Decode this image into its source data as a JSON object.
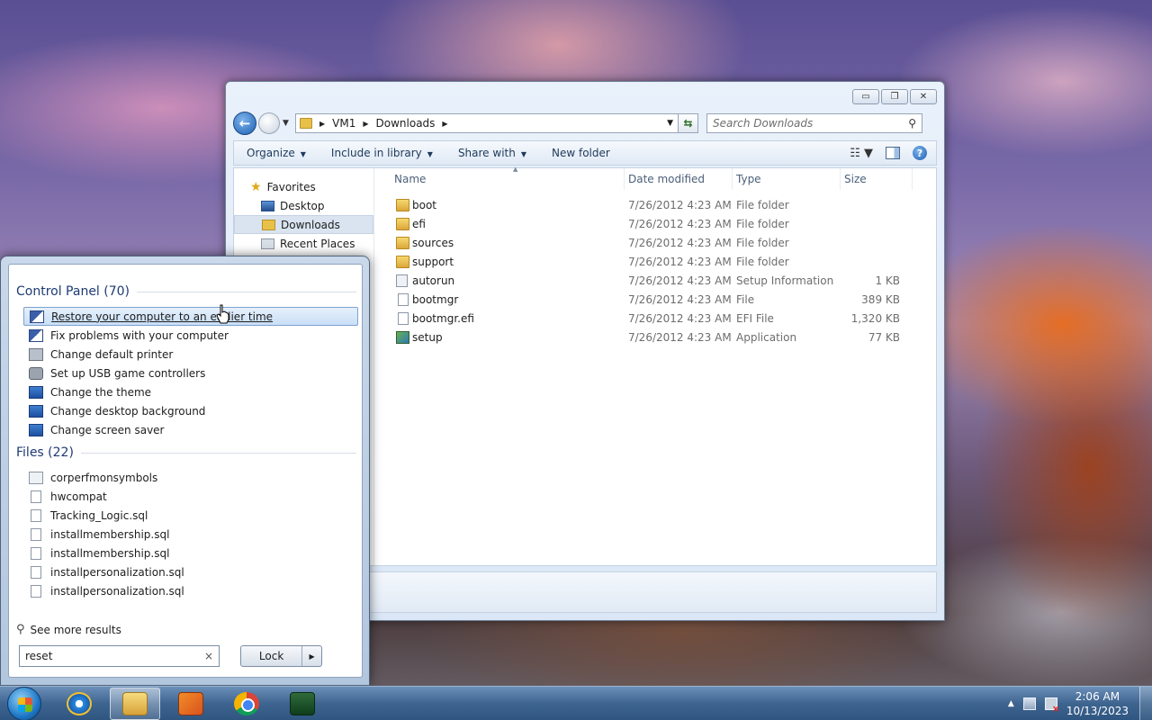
{
  "explorer": {
    "window_controls": {
      "minimize": "▭",
      "maximize": "❐",
      "close": "✕"
    },
    "address": {
      "crumbs": [
        "VM1",
        "Downloads"
      ]
    },
    "search": {
      "placeholder": "Search Downloads"
    },
    "toolbar": {
      "organize": "Organize",
      "include_in_library": "Include in library",
      "share_with": "Share with",
      "new_folder": "New folder"
    },
    "nav_pane": {
      "favorites": "Favorites",
      "items": [
        "Desktop",
        "Downloads",
        "Recent Places"
      ],
      "selected": "Downloads"
    },
    "columns": {
      "name": "Name",
      "date_modified": "Date modified",
      "type": "Type",
      "size": "Size"
    },
    "files": [
      {
        "name": "boot",
        "date": "7/26/2012 4:23 AM",
        "type": "File folder",
        "size": "",
        "icon": "folder-icon"
      },
      {
        "name": "efi",
        "date": "7/26/2012 4:23 AM",
        "type": "File folder",
        "size": "",
        "icon": "folder-icon"
      },
      {
        "name": "sources",
        "date": "7/26/2012 4:23 AM",
        "type": "File folder",
        "size": "",
        "icon": "folder-icon"
      },
      {
        "name": "support",
        "date": "7/26/2012 4:23 AM",
        "type": "File folder",
        "size": "",
        "icon": "folder-icon"
      },
      {
        "name": "autorun",
        "date": "7/26/2012 4:23 AM",
        "type": "Setup Information",
        "size": "1 KB",
        "icon": "settings-file-icon"
      },
      {
        "name": "bootmgr",
        "date": "7/26/2012 4:23 AM",
        "type": "File",
        "size": "389 KB",
        "icon": "file-icon"
      },
      {
        "name": "bootmgr.efi",
        "date": "7/26/2012 4:23 AM",
        "type": "EFI File",
        "size": "1,320 KB",
        "icon": "file-icon"
      },
      {
        "name": "setup",
        "date": "7/26/2012 4:23 AM",
        "type": "Application",
        "size": "77 KB",
        "icon": "application-icon"
      }
    ]
  },
  "start_menu": {
    "control_panel": {
      "heading": "Control Panel (70)",
      "items": [
        {
          "label": "Restore your computer to an earlier time",
          "icon": "action-center-flag-icon",
          "highlighted": true
        },
        {
          "label": "Fix problems with your computer",
          "icon": "action-center-flag-icon",
          "highlighted": false
        },
        {
          "label": "Change default printer",
          "icon": "printer-icon",
          "highlighted": false
        },
        {
          "label": "Set up USB game controllers",
          "icon": "game-controller-icon",
          "highlighted": false
        },
        {
          "label": "Change the theme",
          "icon": "personalization-icon",
          "highlighted": false
        },
        {
          "label": "Change desktop background",
          "icon": "personalization-icon",
          "highlighted": false
        },
        {
          "label": "Change screen saver",
          "icon": "personalization-icon",
          "highlighted": false
        }
      ]
    },
    "files": {
      "heading": "Files (22)",
      "items": [
        {
          "label": "corperfmonsymbols",
          "icon": "settings-file-icon"
        },
        {
          "label": "hwcompat",
          "icon": "text-file-icon"
        },
        {
          "label": "Tracking_Logic.sql",
          "icon": "file-icon"
        },
        {
          "label": "installmembership.sql",
          "icon": "file-icon"
        },
        {
          "label": "installmembership.sql",
          "icon": "file-icon"
        },
        {
          "label": "installpersonalization.sql",
          "icon": "file-icon"
        },
        {
          "label": "installpersonalization.sql",
          "icon": "file-icon"
        }
      ]
    },
    "see_more": "See more results",
    "search": {
      "value": "reset",
      "clear": "×"
    },
    "lock_button": "Lock"
  },
  "taskbar": {
    "apps": [
      {
        "name": "internet-explorer",
        "icon": "internet-explorer-icon"
      },
      {
        "name": "windows-explorer",
        "icon": "folder-icon",
        "active": true
      },
      {
        "name": "media-player",
        "icon": "media-player-icon"
      },
      {
        "name": "chrome",
        "icon": "chrome-icon"
      },
      {
        "name": "task-manager",
        "icon": "task-manager-icon"
      }
    ],
    "clock": {
      "time": "2:06 AM",
      "date": "10/13/2023"
    }
  }
}
